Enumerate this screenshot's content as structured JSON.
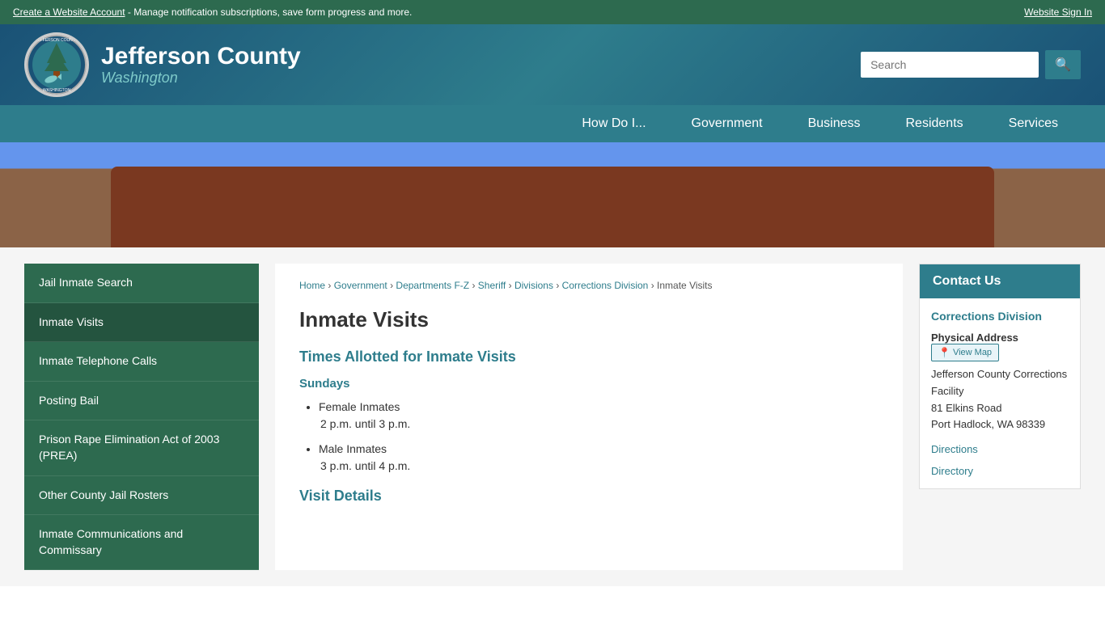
{
  "topbar": {
    "left_text": "Create a Website Account",
    "left_suffix": " - Manage notification subscriptions, save form progress and more.",
    "right_text": "Website Sign In"
  },
  "header": {
    "org_name": "Jefferson County",
    "org_subtitle": "Washington",
    "search_placeholder": "Search",
    "search_button_label": "🔍"
  },
  "nav": {
    "items": [
      {
        "label": "How Do I...",
        "id": "how-do-i"
      },
      {
        "label": "Government",
        "id": "government"
      },
      {
        "label": "Business",
        "id": "business"
      },
      {
        "label": "Residents",
        "id": "residents"
      },
      {
        "label": "Services",
        "id": "services"
      }
    ]
  },
  "sidebar": {
    "items": [
      {
        "label": "Jail Inmate Search",
        "id": "jail-inmate-search"
      },
      {
        "label": "Inmate Visits",
        "id": "inmate-visits",
        "active": true
      },
      {
        "label": "Inmate Telephone Calls",
        "id": "inmate-telephone-calls"
      },
      {
        "label": "Posting Bail",
        "id": "posting-bail"
      },
      {
        "label": "Prison Rape Elimination Act of 2003 (PREA)",
        "id": "prea"
      },
      {
        "label": "Other County Jail Rosters",
        "id": "other-county-jail-rosters"
      },
      {
        "label": "Inmate Communications and Commissary",
        "id": "inmate-communications"
      }
    ]
  },
  "breadcrumb": {
    "items": [
      {
        "label": "Home",
        "href": "#"
      },
      {
        "label": "Government",
        "href": "#"
      },
      {
        "label": "Departments F-Z",
        "href": "#"
      },
      {
        "label": "Sheriff",
        "href": "#"
      },
      {
        "label": "Divisions",
        "href": "#"
      },
      {
        "label": "Corrections Division",
        "href": "#"
      }
    ],
    "current": "Inmate Visits"
  },
  "main": {
    "page_title": "Inmate Visits",
    "section1_heading": "Times Allotted for Inmate Visits",
    "sundays_heading": "Sundays",
    "visit_items": [
      {
        "type": "Female Inmates",
        "time": "2 p.m. until 3 p.m."
      },
      {
        "type": "Male Inmates",
        "time": "3 p.m. until 4 p.m."
      }
    ],
    "section2_heading": "Visit Details"
  },
  "contact": {
    "header": "Contact Us",
    "division_name": "Corrections Division",
    "address_label": "Physical Address",
    "view_map_label": "View Map",
    "address_line1": "Jefferson County Corrections Facility",
    "address_line2": "81 Elkins Road",
    "address_line3": "Port Hadlock, WA 98339",
    "directions_label": "Directions",
    "directory_label": "Directory"
  }
}
